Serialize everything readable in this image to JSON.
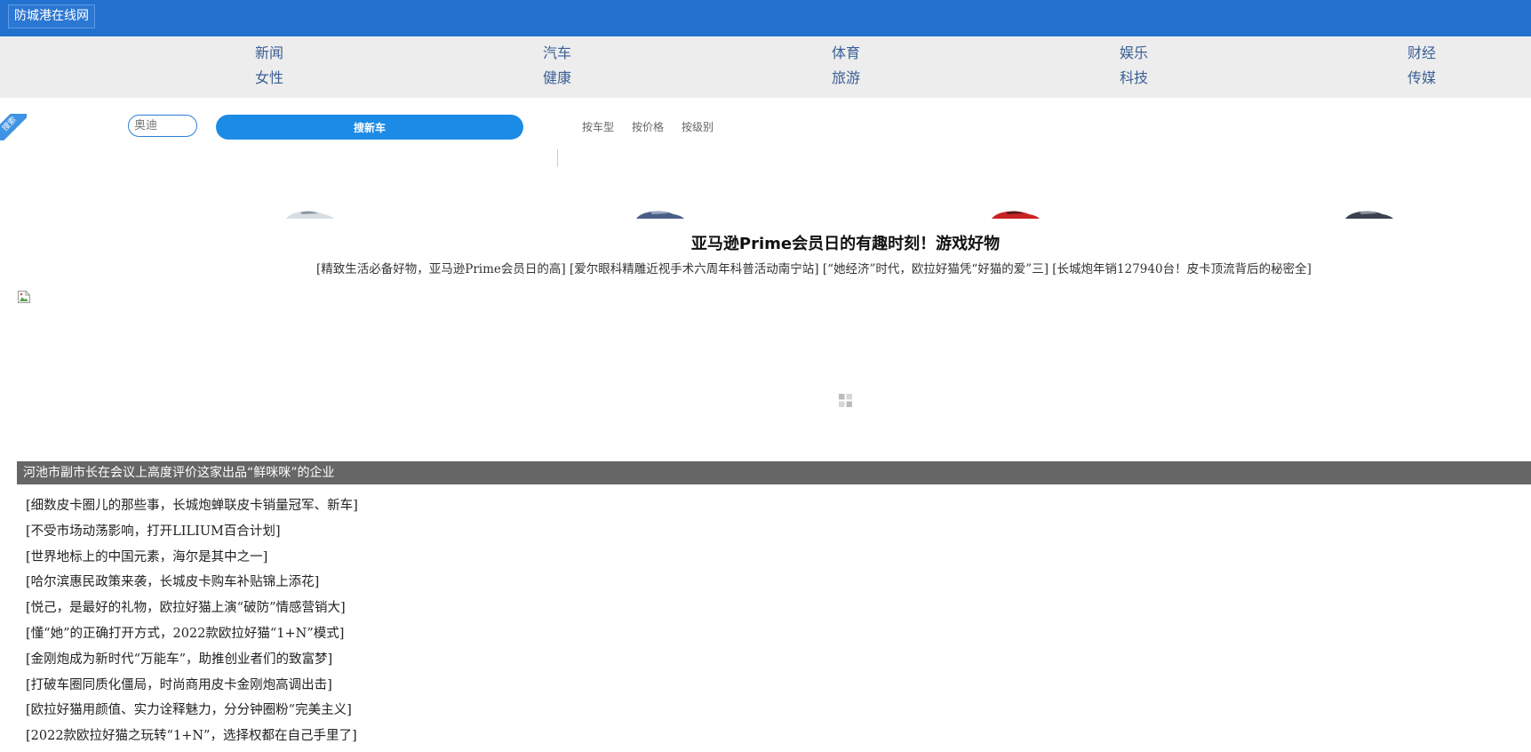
{
  "header": {
    "site_title": "防城港在线网",
    "brand_color": "#2271cf"
  },
  "nav": {
    "row1": [
      "新闻",
      "汽车",
      "体育",
      "娱乐",
      "财经"
    ],
    "row2": [
      "女性",
      "健康",
      "旅游",
      "科技",
      "传媒"
    ]
  },
  "search": {
    "ribbon_label": "搜索",
    "input_placeholder": "奥迪",
    "button_label": "搜新车",
    "filters": [
      "按车型",
      "按价格",
      "按级别"
    ]
  },
  "headline": {
    "title": "亚马逊Prime会员日的有趣时刻！游戏好物",
    "related": [
      "[精致生活必备好物，亚马逊Prime会员日的高]",
      "[爱尔眼科精雕近视手术六周年科普活动南宁站]",
      "[“她经济”时代，欧拉好猫凭“好猫的爱”三]",
      "[长城炮年销127940台！皮卡顶流背后的秘密全]"
    ]
  },
  "section": {
    "title": "河池市副市长在会议上高度评价这家出品“鲜咪咪”的企业"
  },
  "news": [
    "[细数皮卡圈儿的那些事，长城炮蝉联皮卡销量冠军、新车]",
    "[不受市场动荡影响，打开LILIUM百合计划]",
    "[世界地标上的中国元素，海尔是其中之一]",
    "[哈尔滨惠民政策来袭，长城皮卡购车补贴锦上添花]",
    "[悦己，是最好的礼物，欧拉好猫上演“破防”情感营销大]",
    "[懂“她”的正确打开方式，2022款欧拉好猫“1+N”模式]",
    "[金刚炮成为新时代“万能车”，助推创业者们的致富梦]",
    "[打破车圈同质化僵局，时尚商用皮卡金刚炮高调出击]",
    "[欧拉好猫用颜值、实力诠释魅力，分分钟圈粉“完美主义]",
    "[2022款欧拉好猫之玩转“1+N”，选择权都在自己手里了]"
  ]
}
